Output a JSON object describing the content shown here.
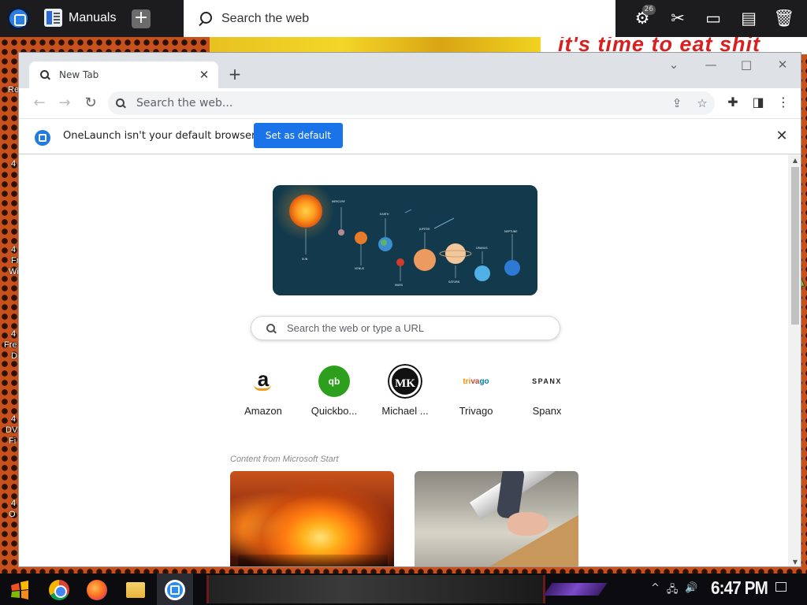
{
  "dock": {
    "app_label": "Manuals",
    "search_placeholder": "Search the web",
    "badge_count": "26",
    "icons": [
      "onelaunch-logo-icon",
      "manuals-app-icon",
      "add-app-icon",
      "search-icon",
      "clipboard-badge-icon",
      "scissors-icon",
      "video-icon",
      "notes-icon",
      "trash-icon"
    ]
  },
  "wallpaper": {
    "banner_text": "it's time to eat shit",
    "desktop_fragments": [
      "Re",
      "4",
      "4",
      "Fr",
      "Wi",
      "4",
      "Fre",
      "D",
      "4",
      "DV",
      "Fi",
      "4",
      "O"
    ]
  },
  "browser": {
    "tab_title": "New Tab",
    "omnibox_placeholder": "Search the web...",
    "infobar": {
      "message": "OneLaunch isn't your default browser",
      "button_label": "Set as default"
    },
    "ntp": {
      "planet_labels": [
        "MERCURY",
        "EARTH",
        "JUPITER",
        "URANUS",
        "NEPTUNE",
        "SUN",
        "VENUS",
        "MARS",
        "SATURN"
      ],
      "search_placeholder": "Search the web or type a URL",
      "shortcuts": [
        {
          "label": "Amazon",
          "icon": "amazon-icon"
        },
        {
          "label": "Quickbo...",
          "icon": "quickbooks-icon"
        },
        {
          "label": "Michael ...",
          "icon": "michael-kors-icon"
        },
        {
          "label": "Trivago",
          "icon": "trivago-icon"
        },
        {
          "label": "Spanx",
          "icon": "spanx-icon"
        }
      ],
      "shortcut_glyphs": {
        "amazon": "a",
        "quickbooks": "qb",
        "michael_kors": "MK",
        "trivago_parts": [
          "tri",
          "va",
          "go"
        ],
        "spanx": "SPANX"
      },
      "content_from": "Content from Microsoft Start"
    }
  },
  "taskbar": {
    "clock": "6:47 PM",
    "pinned": [
      "chrome-icon",
      "firefox-icon",
      "file-explorer-icon",
      "onelaunch-icon"
    ]
  },
  "colors": {
    "accent_blue": "#1a73e8",
    "dock_bg": "#1c1c1e",
    "taskbar_bg": "#0b0b10",
    "wall_orange": "#c8501c"
  }
}
